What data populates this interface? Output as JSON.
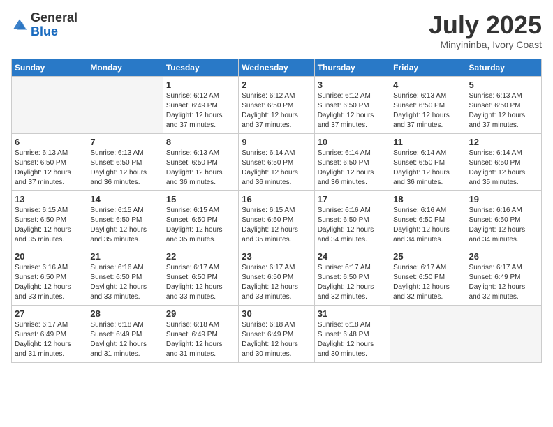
{
  "logo": {
    "general": "General",
    "blue": "Blue"
  },
  "header": {
    "month": "July 2025",
    "location": "Minyininba, Ivory Coast"
  },
  "weekdays": [
    "Sunday",
    "Monday",
    "Tuesday",
    "Wednesday",
    "Thursday",
    "Friday",
    "Saturday"
  ],
  "weeks": [
    [
      {
        "day": "",
        "empty": true
      },
      {
        "day": "",
        "empty": true
      },
      {
        "day": "1",
        "sunrise": "6:12 AM",
        "sunset": "6:49 PM",
        "daylight": "12 hours and 37 minutes."
      },
      {
        "day": "2",
        "sunrise": "6:12 AM",
        "sunset": "6:50 PM",
        "daylight": "12 hours and 37 minutes."
      },
      {
        "day": "3",
        "sunrise": "6:12 AM",
        "sunset": "6:50 PM",
        "daylight": "12 hours and 37 minutes."
      },
      {
        "day": "4",
        "sunrise": "6:13 AM",
        "sunset": "6:50 PM",
        "daylight": "12 hours and 37 minutes."
      },
      {
        "day": "5",
        "sunrise": "6:13 AM",
        "sunset": "6:50 PM",
        "daylight": "12 hours and 37 minutes."
      }
    ],
    [
      {
        "day": "6",
        "sunrise": "6:13 AM",
        "sunset": "6:50 PM",
        "daylight": "12 hours and 37 minutes."
      },
      {
        "day": "7",
        "sunrise": "6:13 AM",
        "sunset": "6:50 PM",
        "daylight": "12 hours and 36 minutes."
      },
      {
        "day": "8",
        "sunrise": "6:13 AM",
        "sunset": "6:50 PM",
        "daylight": "12 hours and 36 minutes."
      },
      {
        "day": "9",
        "sunrise": "6:14 AM",
        "sunset": "6:50 PM",
        "daylight": "12 hours and 36 minutes."
      },
      {
        "day": "10",
        "sunrise": "6:14 AM",
        "sunset": "6:50 PM",
        "daylight": "12 hours and 36 minutes."
      },
      {
        "day": "11",
        "sunrise": "6:14 AM",
        "sunset": "6:50 PM",
        "daylight": "12 hours and 36 minutes."
      },
      {
        "day": "12",
        "sunrise": "6:14 AM",
        "sunset": "6:50 PM",
        "daylight": "12 hours and 35 minutes."
      }
    ],
    [
      {
        "day": "13",
        "sunrise": "6:15 AM",
        "sunset": "6:50 PM",
        "daylight": "12 hours and 35 minutes."
      },
      {
        "day": "14",
        "sunrise": "6:15 AM",
        "sunset": "6:50 PM",
        "daylight": "12 hours and 35 minutes."
      },
      {
        "day": "15",
        "sunrise": "6:15 AM",
        "sunset": "6:50 PM",
        "daylight": "12 hours and 35 minutes."
      },
      {
        "day": "16",
        "sunrise": "6:15 AM",
        "sunset": "6:50 PM",
        "daylight": "12 hours and 35 minutes."
      },
      {
        "day": "17",
        "sunrise": "6:16 AM",
        "sunset": "6:50 PM",
        "daylight": "12 hours and 34 minutes."
      },
      {
        "day": "18",
        "sunrise": "6:16 AM",
        "sunset": "6:50 PM",
        "daylight": "12 hours and 34 minutes."
      },
      {
        "day": "19",
        "sunrise": "6:16 AM",
        "sunset": "6:50 PM",
        "daylight": "12 hours and 34 minutes."
      }
    ],
    [
      {
        "day": "20",
        "sunrise": "6:16 AM",
        "sunset": "6:50 PM",
        "daylight": "12 hours and 33 minutes."
      },
      {
        "day": "21",
        "sunrise": "6:16 AM",
        "sunset": "6:50 PM",
        "daylight": "12 hours and 33 minutes."
      },
      {
        "day": "22",
        "sunrise": "6:17 AM",
        "sunset": "6:50 PM",
        "daylight": "12 hours and 33 minutes."
      },
      {
        "day": "23",
        "sunrise": "6:17 AM",
        "sunset": "6:50 PM",
        "daylight": "12 hours and 33 minutes."
      },
      {
        "day": "24",
        "sunrise": "6:17 AM",
        "sunset": "6:50 PM",
        "daylight": "12 hours and 32 minutes."
      },
      {
        "day": "25",
        "sunrise": "6:17 AM",
        "sunset": "6:50 PM",
        "daylight": "12 hours and 32 minutes."
      },
      {
        "day": "26",
        "sunrise": "6:17 AM",
        "sunset": "6:49 PM",
        "daylight": "12 hours and 32 minutes."
      }
    ],
    [
      {
        "day": "27",
        "sunrise": "6:17 AM",
        "sunset": "6:49 PM",
        "daylight": "12 hours and 31 minutes."
      },
      {
        "day": "28",
        "sunrise": "6:18 AM",
        "sunset": "6:49 PM",
        "daylight": "12 hours and 31 minutes."
      },
      {
        "day": "29",
        "sunrise": "6:18 AM",
        "sunset": "6:49 PM",
        "daylight": "12 hours and 31 minutes."
      },
      {
        "day": "30",
        "sunrise": "6:18 AM",
        "sunset": "6:49 PM",
        "daylight": "12 hours and 30 minutes."
      },
      {
        "day": "31",
        "sunrise": "6:18 AM",
        "sunset": "6:48 PM",
        "daylight": "12 hours and 30 minutes."
      },
      {
        "day": "",
        "empty": true
      },
      {
        "day": "",
        "empty": true
      }
    ]
  ]
}
